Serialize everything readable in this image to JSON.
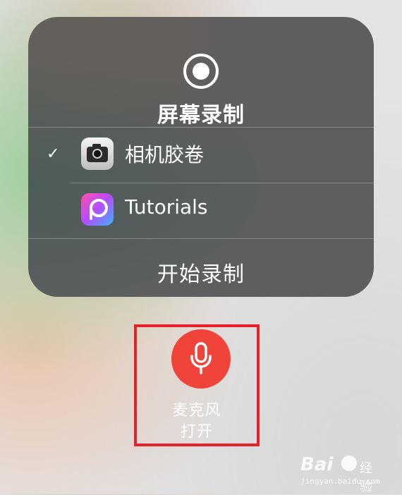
{
  "panel": {
    "title": "屏幕录制",
    "destinations": [
      {
        "label": "相机胶卷",
        "selected": true,
        "icon": "camera-icon"
      },
      {
        "label": "Tutorials",
        "selected": false,
        "icon": "picsart-icon"
      }
    ],
    "start_label": "开始录制"
  },
  "microphone": {
    "label": "麦克风",
    "status": "打开",
    "color": "#f0443a"
  },
  "highlight_color": "#e8202a",
  "watermark": {
    "brand": "Bai",
    "text": "经验",
    "url": "jingyan.baidu.com"
  }
}
